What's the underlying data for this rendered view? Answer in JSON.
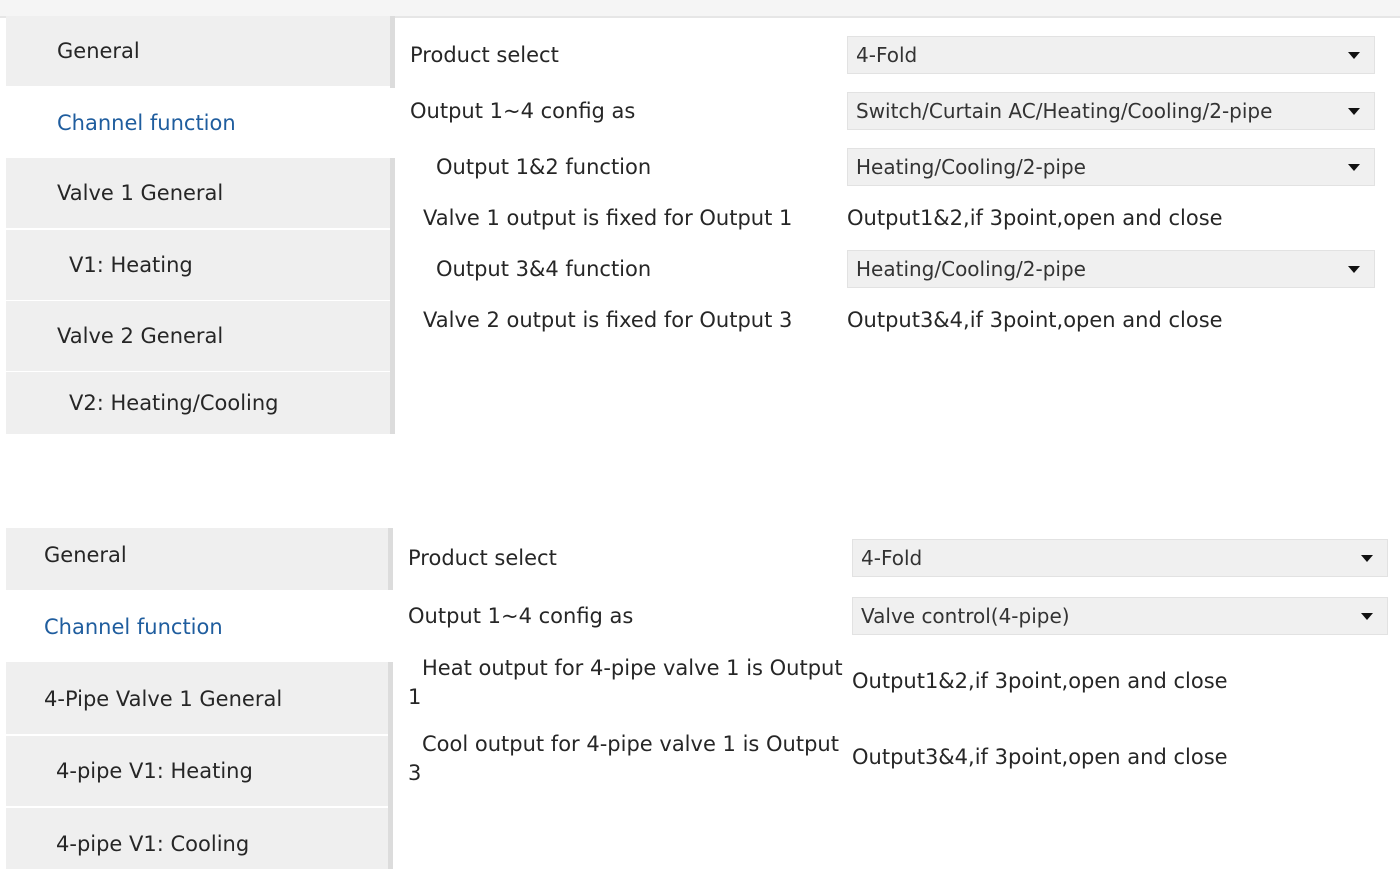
{
  "panel1": {
    "sidebar": [
      {
        "label": "General",
        "active": false
      },
      {
        "label": "Channel function",
        "active": true
      },
      {
        "label": "Valve 1 General",
        "active": false
      },
      {
        "label": "V1: Heating",
        "active": false
      },
      {
        "label": "Valve 2 General",
        "active": false
      },
      {
        "label": "V2: Heating/Cooling",
        "active": false
      }
    ],
    "rows": {
      "product_select": {
        "label": "Product select",
        "value": "4-Fold"
      },
      "output_config": {
        "label": "Output 1~4 config as",
        "value": "Switch/Curtain AC/Heating/Cooling/2-pipe"
      },
      "output12_function": {
        "label": "Output 1&2 function",
        "value": "Heating/Cooling/2-pipe"
      },
      "valve1_fixed": {
        "label": "Valve 1 output is fixed for Output 1",
        "value": "Output1&2,if 3point,open and close"
      },
      "output34_function": {
        "label": "Output 3&4 function",
        "value": "Heating/Cooling/2-pipe"
      },
      "valve2_fixed": {
        "label": "Valve 2 output is fixed for Output 3",
        "value": "Output3&4,if 3point,open and close"
      }
    }
  },
  "panel2": {
    "sidebar": [
      {
        "label": "General",
        "active": false
      },
      {
        "label": "Channel function",
        "active": true
      },
      {
        "label": "4-Pipe Valve 1 General",
        "active": false
      },
      {
        "label": "4-pipe V1: Heating",
        "active": false
      },
      {
        "label": "4-pipe V1: Cooling",
        "active": false
      }
    ],
    "rows": {
      "product_select": {
        "label": "Product select",
        "value": "4-Fold"
      },
      "output_config": {
        "label": "Output 1~4 config as",
        "value": "Valve control(4-pipe)"
      },
      "heat_output": {
        "label_line1": "Heat output for 4-pipe valve 1 is Output",
        "label_line2": "1",
        "value": "Output1&2,if 3point,open and close"
      },
      "cool_output": {
        "label_line1": "Cool output for 4-pipe valve 1 is Output",
        "label_line2": "3",
        "value": "Output3&4,if 3point,open and close"
      }
    }
  },
  "icons": {
    "dropdown": "chevron-down-icon"
  },
  "colors": {
    "active_nav": "#1f5d9e",
    "nav_bg": "#efefef",
    "select_bg": "#f0f0f0"
  }
}
